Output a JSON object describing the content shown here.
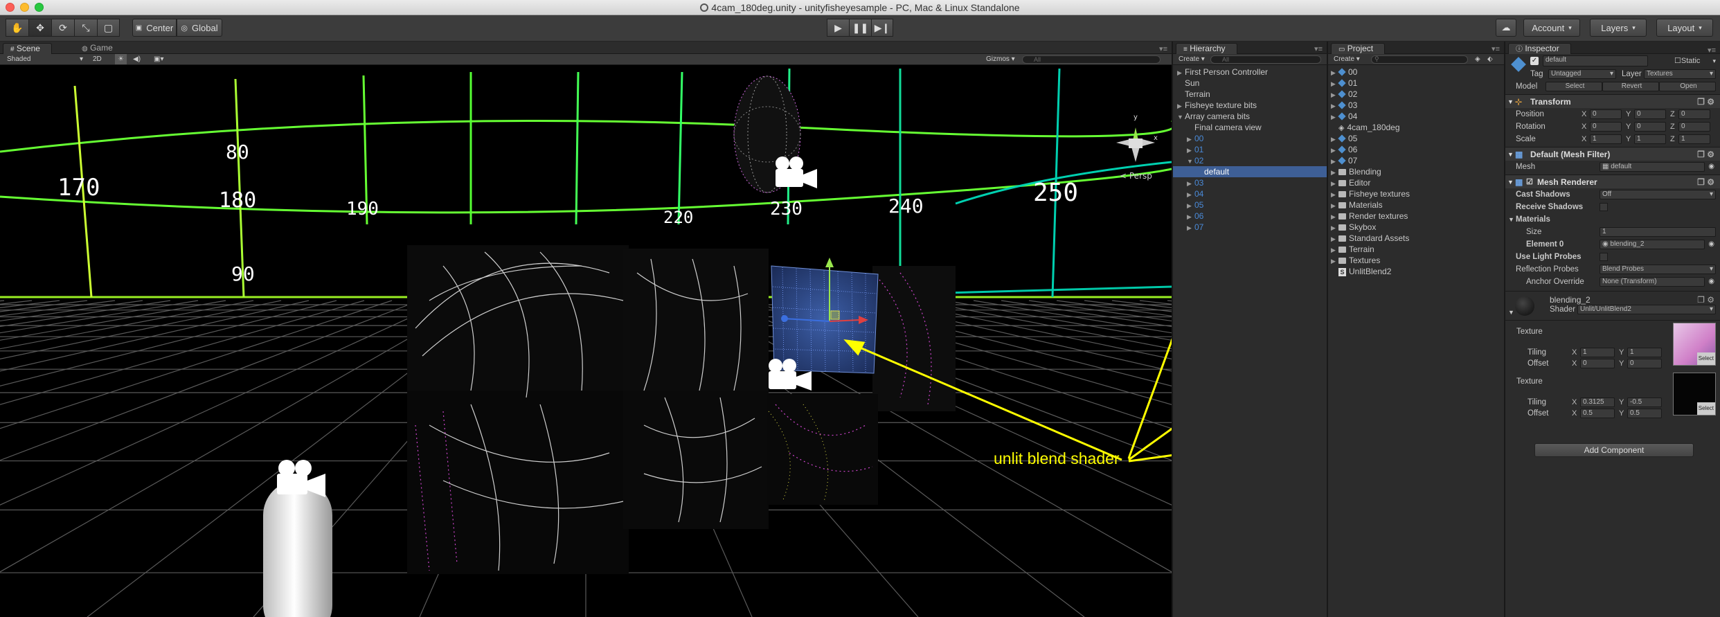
{
  "window": {
    "title": "4cam_180deg.unity - unityfisheyesample - PC, Mac & Linux Standalone"
  },
  "toolbar": {
    "tools": [
      "hand-icon",
      "move-icon",
      "rotate-icon",
      "scale-icon",
      "rect-icon"
    ],
    "pivot": "Center",
    "space": "Global",
    "account": "Account",
    "layers": "Layers",
    "layout": "Layout"
  },
  "scene": {
    "tabs": [
      "Scene",
      "Game"
    ],
    "mode": "Shaded",
    "twod": "2D",
    "gizmos": "Gizmos",
    "search_placeholder": "All",
    "persp": "Persp",
    "grid_labels": [
      "170",
      "80",
      "180",
      "190",
      "230",
      "240",
      "250",
      "90",
      "220"
    ],
    "annotation": "unlit blend shader",
    "colors": {
      "annotation": "#ffff00",
      "grid_green": "#66ff33",
      "grid_cyan": "#00d0b0"
    }
  },
  "hierarchy": {
    "title": "Hierarchy",
    "create": "Create",
    "search_placeholder": "All",
    "items": [
      {
        "label": "First Person Controller",
        "indent": 0,
        "arrow": "right"
      },
      {
        "label": "Sun",
        "indent": 0,
        "arrow": ""
      },
      {
        "label": "Terrain",
        "indent": 0,
        "arrow": ""
      },
      {
        "label": "Fisheye texture bits",
        "indent": 0,
        "arrow": "right"
      },
      {
        "label": "Array camera bits",
        "indent": 0,
        "arrow": "down"
      },
      {
        "label": "Final camera view",
        "indent": 1,
        "arrow": ""
      },
      {
        "label": "00",
        "indent": 1,
        "arrow": "right",
        "prefab": true
      },
      {
        "label": "01",
        "indent": 1,
        "arrow": "right",
        "prefab": true
      },
      {
        "label": "02",
        "indent": 1,
        "arrow": "down",
        "prefab": true
      },
      {
        "label": "default",
        "indent": 2,
        "arrow": "",
        "prefab": true,
        "selected": true
      },
      {
        "label": "03",
        "indent": 1,
        "arrow": "right",
        "prefab": true
      },
      {
        "label": "04",
        "indent": 1,
        "arrow": "right",
        "prefab": true
      },
      {
        "label": "05",
        "indent": 1,
        "arrow": "right",
        "prefab": true
      },
      {
        "label": "06",
        "indent": 1,
        "arrow": "right",
        "prefab": true
      },
      {
        "label": "07",
        "indent": 1,
        "arrow": "right",
        "prefab": true
      }
    ]
  },
  "project": {
    "title": "Project",
    "create": "Create",
    "items": [
      {
        "label": "00",
        "kind": "prefab",
        "arrow": true
      },
      {
        "label": "01",
        "kind": "prefab",
        "arrow": true
      },
      {
        "label": "02",
        "kind": "prefab",
        "arrow": true
      },
      {
        "label": "03",
        "kind": "prefab",
        "arrow": true
      },
      {
        "label": "04",
        "kind": "prefab",
        "arrow": true
      },
      {
        "label": "4cam_180deg",
        "kind": "scene",
        "arrow": false
      },
      {
        "label": "05",
        "kind": "prefab",
        "arrow": true
      },
      {
        "label": "06",
        "kind": "prefab",
        "arrow": true
      },
      {
        "label": "07",
        "kind": "prefab",
        "arrow": true
      },
      {
        "label": "Blending",
        "kind": "folder",
        "arrow": true
      },
      {
        "label": "Editor",
        "kind": "folder",
        "arrow": true
      },
      {
        "label": "Fisheye textures",
        "kind": "folder",
        "arrow": true
      },
      {
        "label": "Materials",
        "kind": "folder",
        "arrow": true
      },
      {
        "label": "Render textures",
        "kind": "folder",
        "arrow": true
      },
      {
        "label": "Skybox",
        "kind": "folder",
        "arrow": true
      },
      {
        "label": "Standard Assets",
        "kind": "folder",
        "arrow": true
      },
      {
        "label": "Terrain",
        "kind": "folder",
        "arrow": true
      },
      {
        "label": "Textures",
        "kind": "folder",
        "arrow": true
      },
      {
        "label": "UnlitBlend2",
        "kind": "shader",
        "arrow": false
      }
    ]
  },
  "inspector": {
    "title": "Inspector",
    "object_name": "default",
    "static": "Static",
    "tag_label": "Tag",
    "tag": "Untagged",
    "layer_label": "Layer",
    "layer": "Textures",
    "model_label": "Model",
    "model_buttons": [
      "Select",
      "Revert",
      "Open"
    ],
    "transform": {
      "title": "Transform",
      "rows": [
        {
          "label": "Position",
          "x": "0",
          "y": "0",
          "z": "0"
        },
        {
          "label": "Rotation",
          "x": "0",
          "y": "0",
          "z": "0"
        },
        {
          "label": "Scale",
          "x": "1",
          "y": "1",
          "z": "1"
        }
      ]
    },
    "mesh_filter": {
      "title": "Default (Mesh Filter)",
      "mesh_label": "Mesh",
      "mesh": "default"
    },
    "mesh_renderer": {
      "title": "Mesh Renderer",
      "cast_shadows_label": "Cast Shadows",
      "cast_shadows": "Off",
      "receive_shadows_label": "Receive Shadows",
      "materials_label": "Materials",
      "size_label": "Size",
      "size": "1",
      "element0_label": "Element 0",
      "element0": "blending_2",
      "light_probes_label": "Use Light Probes",
      "reflection_label": "Reflection Probes",
      "reflection": "Blend Probes",
      "anchor_label": "Anchor Override",
      "anchor": "None (Transform)"
    },
    "material": {
      "name": "blending_2",
      "shader_label": "Shader",
      "shader": "Unlit/UnlitBlend2",
      "textures": [
        {
          "label": "Texture",
          "tiling_label": "Tiling",
          "tiling_x": "1",
          "tiling_y": "1",
          "offset_label": "Offset",
          "offset_x": "0",
          "offset_y": "0",
          "select": "Select"
        },
        {
          "label": "Texture",
          "tiling_label": "Tiling",
          "tiling_x": "0.3125",
          "tiling_y": "-0.5",
          "offset_label": "Offset",
          "offset_x": "0.5",
          "offset_y": "0.5",
          "select": "Select"
        }
      ]
    },
    "add_component": "Add Component"
  }
}
